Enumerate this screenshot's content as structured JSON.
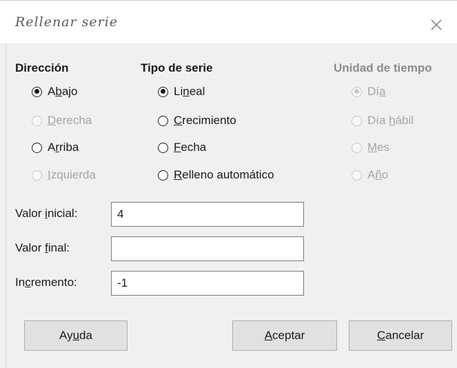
{
  "dialog": {
    "title": "Rellenar serie",
    "close_icon": "close-icon"
  },
  "direction": {
    "title": "Dirección",
    "options": [
      {
        "pre": "A",
        "u": "b",
        "post": "ajo",
        "checked": true,
        "disabled": false
      },
      {
        "pre": "",
        "u": "D",
        "post": "erecha",
        "checked": false,
        "disabled": true
      },
      {
        "pre": "A",
        "u": "r",
        "post": "riba",
        "checked": false,
        "disabled": false
      },
      {
        "pre": "",
        "u": "I",
        "post": "zquierda",
        "checked": false,
        "disabled": true
      }
    ]
  },
  "series_type": {
    "title": "Tipo de serie",
    "options": [
      {
        "pre": "Li",
        "u": "n",
        "post": "eal",
        "checked": true,
        "disabled": false
      },
      {
        "pre": "",
        "u": "C",
        "post": "recimiento",
        "checked": false,
        "disabled": false
      },
      {
        "pre": "",
        "u": "F",
        "post": "echa",
        "checked": false,
        "disabled": false
      },
      {
        "pre": "",
        "u": "R",
        "post": "elleno automático",
        "checked": false,
        "disabled": false
      }
    ]
  },
  "time_unit": {
    "title": "Unidad de tiempo",
    "options": [
      {
        "pre": "Dí",
        "u": "a",
        "post": "",
        "checked": true,
        "disabled": true
      },
      {
        "pre": "Día ",
        "u": "h",
        "post": "ábil",
        "checked": false,
        "disabled": true
      },
      {
        "pre": "",
        "u": "M",
        "post": "es",
        "checked": false,
        "disabled": true
      },
      {
        "pre": "A",
        "u": "ñ",
        "post": "o",
        "checked": false,
        "disabled": true
      }
    ]
  },
  "fields": {
    "start": {
      "pre": "Valor ",
      "u": "i",
      "post": "nicial:",
      "value": "4"
    },
    "end": {
      "pre": "Valor ",
      "u": "f",
      "post": "inal:",
      "value": ""
    },
    "increment": {
      "pre": "In",
      "u": "c",
      "post": "remento:",
      "value": "-1"
    }
  },
  "buttons": {
    "help": {
      "pre": "Ay",
      "u": "u",
      "post": "da"
    },
    "ok": {
      "pre": "",
      "u": "A",
      "post": "ceptar"
    },
    "cancel": {
      "pre": "",
      "u": "C",
      "post": "ancelar"
    }
  }
}
